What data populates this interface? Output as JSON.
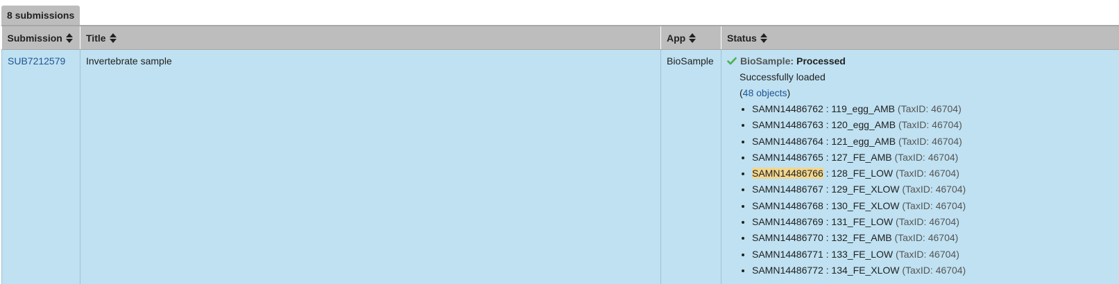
{
  "tab": {
    "label": "8 submissions"
  },
  "columns": [
    {
      "label": "Submission"
    },
    {
      "label": "Title"
    },
    {
      "label": "App"
    },
    {
      "label": "Status"
    }
  ],
  "row": {
    "submission_id": "SUB7212579",
    "title": "Invertebrate sample",
    "app": "BioSample",
    "status": {
      "app_label": "BioSample:",
      "state": "Processed",
      "message": "Successfully loaded",
      "objects_open": "(",
      "objects_link": "48 objects",
      "objects_close": ")",
      "objects": [
        {
          "accession": "SAMN14486762",
          "sep": " : ",
          "name": "119_egg_AMB",
          "taxid": "(TaxID: 46704)"
        },
        {
          "accession": "SAMN14486763",
          "sep": " : ",
          "name": "120_egg_AMB",
          "taxid": "(TaxID: 46704)"
        },
        {
          "accession": "SAMN14486764",
          "sep": " : ",
          "name": "121_egg_AMB",
          "taxid": "(TaxID: 46704)"
        },
        {
          "accession": "SAMN14486765",
          "sep": " : ",
          "name": "127_FE_AMB",
          "taxid": "(TaxID: 46704)"
        },
        {
          "accession": "SAMN14486766",
          "sep": " : ",
          "name": "128_FE_LOW",
          "taxid": "(TaxID: 46704)"
        },
        {
          "accession": "SAMN14486767",
          "sep": " : ",
          "name": "129_FE_XLOW",
          "taxid": "(TaxID: 46704)"
        },
        {
          "accession": "SAMN14486768",
          "sep": " : ",
          "name": "130_FE_XLOW",
          "taxid": "(TaxID: 46704)"
        },
        {
          "accession": "SAMN14486769",
          "sep": " : ",
          "name": "131_FE_LOW",
          "taxid": "(TaxID: 46704)"
        },
        {
          "accession": "SAMN14486770",
          "sep": " : ",
          "name": "132_FE_AMB",
          "taxid": "(TaxID: 46704)"
        },
        {
          "accession": "SAMN14486771",
          "sep": " : ",
          "name": "133_FE_LOW",
          "taxid": "(TaxID: 46704)"
        },
        {
          "accession": "SAMN14486772",
          "sep": " : ",
          "name": "134_FE_XLOW",
          "taxid": "(TaxID: 46704)"
        }
      ]
    }
  },
  "icons": {
    "sort": "sort-both-icon",
    "status": "checkmark-icon"
  },
  "colors": {
    "header_bg": "#bdbdbd",
    "row_bg": "#bfe1f1",
    "link": "#205493",
    "success": "#4caf50",
    "highlight": "#f2d68e"
  }
}
